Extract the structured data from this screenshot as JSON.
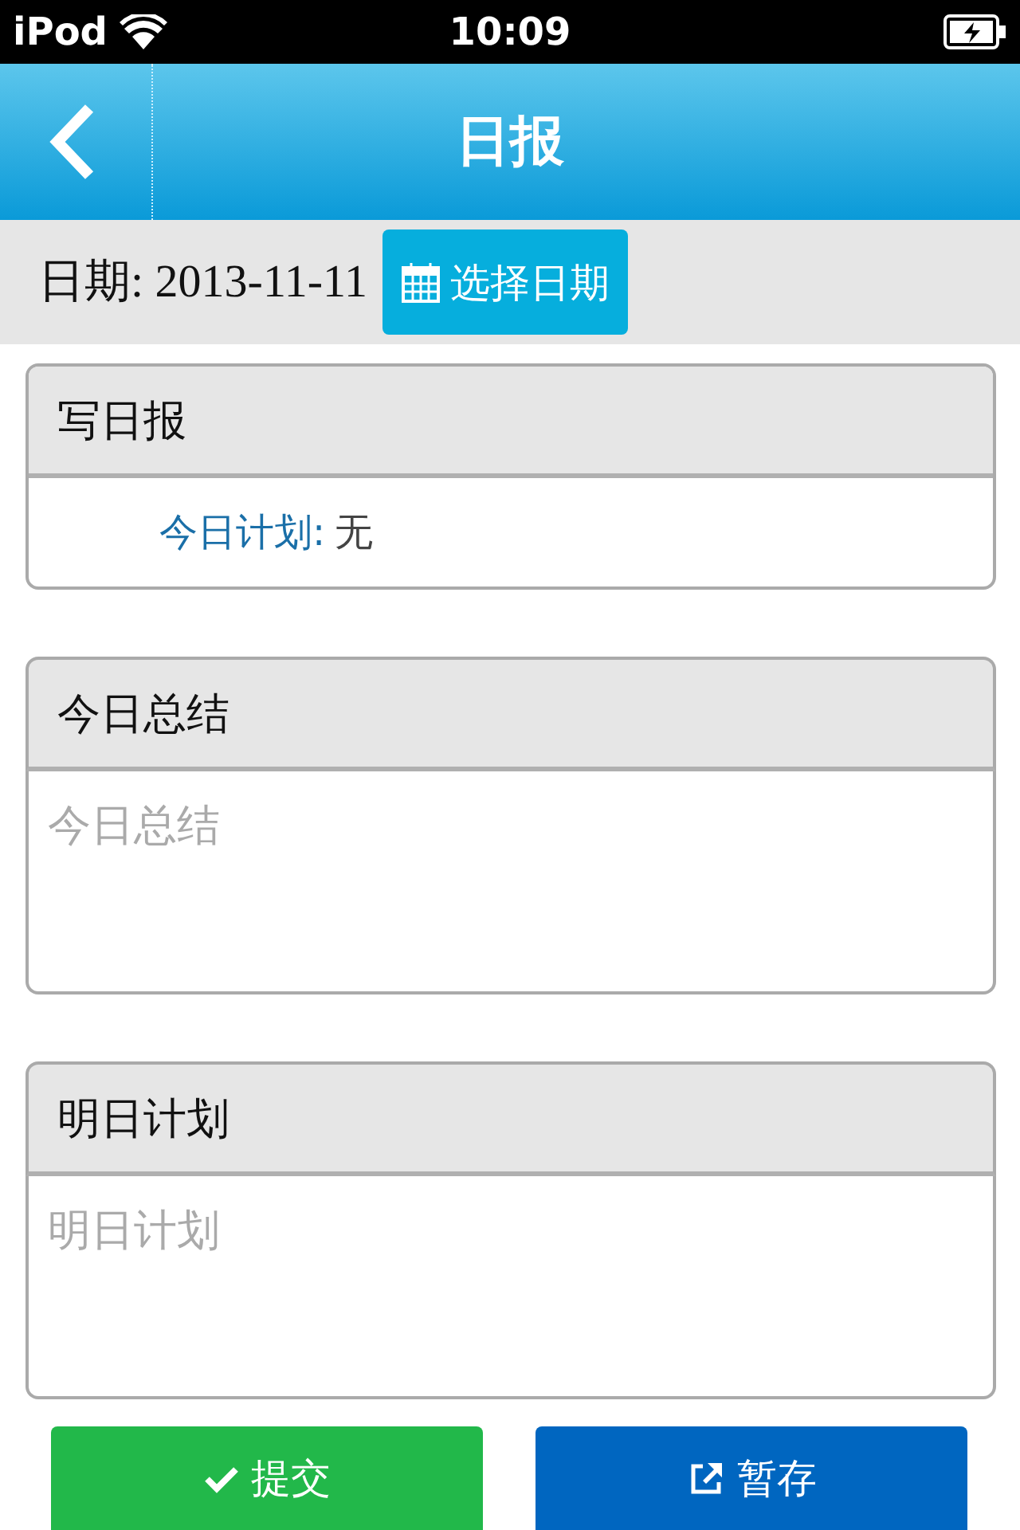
{
  "status_bar": {
    "carrier": "iPod",
    "time": "10:09"
  },
  "header": {
    "title": "日报"
  },
  "date_bar": {
    "label": "日期: 2013-11-11",
    "button": "选择日期"
  },
  "sections": [
    {
      "kind": "info",
      "title": "写日报",
      "label": "今日计划:",
      "value": "无"
    },
    {
      "kind": "textarea",
      "title": "今日总结",
      "placeholder": "今日总结"
    },
    {
      "kind": "textarea",
      "title": "明日计划",
      "placeholder": "明日计划"
    }
  ],
  "buttons": [
    {
      "kind": "submit",
      "label": "提交"
    },
    {
      "kind": "save",
      "label": "暂存"
    }
  ]
}
